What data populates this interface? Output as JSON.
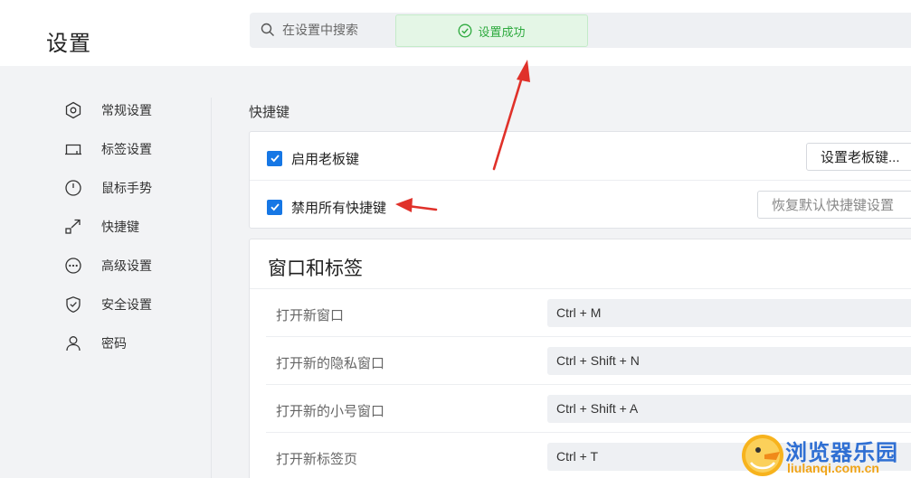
{
  "header": {
    "title": "设置",
    "search_placeholder": "在设置中搜索",
    "toast": "设置成功"
  },
  "sidebar": {
    "items": [
      {
        "label": "常规设置",
        "icon": "hexagon-settings-icon"
      },
      {
        "label": "标签设置",
        "icon": "tab-icon"
      },
      {
        "label": "鼠标手势",
        "icon": "mouse-icon"
      },
      {
        "label": "快捷键",
        "icon": "shortcut-arrow-icon"
      },
      {
        "label": "高级设置",
        "icon": "more-dots-icon"
      },
      {
        "label": "安全设置",
        "icon": "shield-icon"
      },
      {
        "label": "密码",
        "icon": "user-icon"
      }
    ]
  },
  "shortcuts": {
    "section_title": "快捷键",
    "enable_boss_key_label": "启用老板键",
    "enable_boss_key_checked": true,
    "set_boss_key_button": "设置老板键...",
    "disable_all_label": "禁用所有快捷键",
    "disable_all_checked": true,
    "restore_default_button": "恢复默认快捷键设置"
  },
  "window_tabs": {
    "title": "窗口和标签",
    "rows": [
      {
        "name": "打开新窗口",
        "keys": "Ctrl + M"
      },
      {
        "name": "打开新的隐私窗口",
        "keys": "Ctrl + Shift + N"
      },
      {
        "name": "打开新的小号窗口",
        "keys": "Ctrl + Shift + A"
      },
      {
        "name": "打开新标签页",
        "keys": "Ctrl + T"
      }
    ]
  },
  "watermark": {
    "text": "浏览器乐园",
    "url": "liulanqi.com.cn"
  },
  "colors": {
    "accent": "#1677e5",
    "success": "#2eaa3f",
    "annotation_arrow": "#e0312a"
  }
}
